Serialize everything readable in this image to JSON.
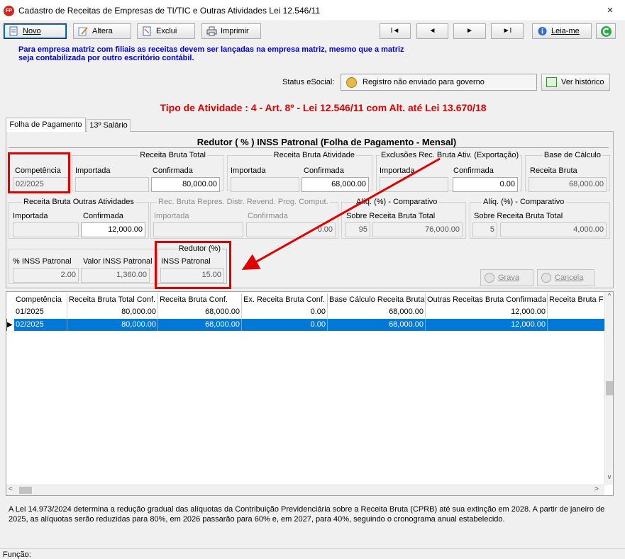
{
  "window": {
    "title": "Cadastro de Receitas de Empresas de TI/TIC e Outras Atividades Lei 12.546/11",
    "app_icon_text": "FP",
    "close": "×"
  },
  "toolbar": {
    "new": "Novo",
    "edit": "Altera",
    "delete": "Exclui",
    "print": "Imprimir",
    "first": "I◄",
    "prev": "◄",
    "next": "►",
    "last": "►I",
    "readme": "Leia-me"
  },
  "info": {
    "matrix_note_line1": "Para empresa matriz com filiais as receitas devem ser lançadas na empresa matriz, mesmo que a matriz",
    "matrix_note_line2": "seja contabilizada por outro escritório contábil.",
    "esocial_label": "Status eSocial:",
    "esocial_status": "Registro não enviado para governo",
    "history_button": "Ver histórico",
    "activity_type": "Tipo de Atividade : 4 - Art. 8º - Lei 12.546/11 com Alt. até Lei 13.670/18"
  },
  "tabs": {
    "payroll": "Folha de Pagamento",
    "thirteenth": "13º Salário"
  },
  "form": {
    "section_title": "Redutor ( % ) INSS Patronal (Folha de Pagamento - Mensal)",
    "competencia_label": "Competência",
    "competencia_value": "02/2025",
    "receita_bruta_total": {
      "title": "Receita Bruta Total",
      "importada": "Importada",
      "confirmada": "Confirmada",
      "importada_value": "",
      "confirmada_value": "80,000.00"
    },
    "receita_bruta_atividade": {
      "title": "Receita Bruta Atividade",
      "importada": "Importada",
      "confirmada": "Confirmada",
      "importada_value": "",
      "confirmada_value": "68,000.00"
    },
    "exclusoes": {
      "title": "Exclusões Rec. Bruta Ativ. (Exportação)",
      "importada": "Importada",
      "confirmada": "Confirmada",
      "importada_value": "",
      "confirmada_value": "0.00"
    },
    "base_calculo": {
      "title": "Base de Cálculo",
      "label": "Receita Bruta",
      "value": "68,000.00"
    },
    "outras_atividades": {
      "title": "Receita Bruta Outras Atividades",
      "importada": "Importada",
      "confirmada": "Confirmada",
      "importada_value": "",
      "confirmada_value": "12,000.00"
    },
    "repres_distr": {
      "title": "Rec. Bruta Repres. Distr. Revend. Prog. Comput.",
      "importada": "Importada",
      "confirmada": "Confirmada",
      "importada_value": "",
      "confirmada_value": "0.00"
    },
    "aliq_comparativo_1": {
      "title": "Alíq. (%) - Comparativo",
      "label": "Sobre Receita Bruta Total",
      "pct": "95",
      "value": "76,000.00"
    },
    "aliq_comparativo_2": {
      "title": "Alíq. (%) - Comparativo",
      "label": "Sobre Receita Bruta Total",
      "pct": "5",
      "value": "4,000.00"
    },
    "inss_patronal_pct_label": "% INSS Patronal",
    "inss_patronal_pct_value": "2.00",
    "valor_inss_label": "Valor INSS Patronal",
    "valor_inss_value": "1,360.00",
    "redutor": {
      "title": "Redutor (%)",
      "label": "INSS Patronal",
      "value": "15.00"
    },
    "save_button": "Grava",
    "cancel_button": "Cancela"
  },
  "grid": {
    "headers": [
      "Competência",
      "Receita Bruta Total Conf.",
      "Receita Bruta Conf.",
      "Ex. Receita Bruta Conf.",
      "Base Cálculo Receita Bruta",
      "Outras Receitas Bruta Confirmada",
      "Receita Bruta F"
    ],
    "rows": [
      [
        "01/2025",
        "80,000.00",
        "68,000.00",
        "0.00",
        "68,000.00",
        "12,000.00",
        ""
      ],
      [
        "02/2025",
        "80,000.00",
        "68,000.00",
        "0.00",
        "68,000.00",
        "12,000.00",
        ""
      ]
    ],
    "selected_marker": "▶",
    "scroll_left": "<",
    "scroll_right": ">",
    "scroll_up": "^",
    "scroll_down": "v"
  },
  "footer": {
    "note": "A Lei 14.973/2024 determina a redução gradual das alíquotas da Contribuição Previdenciária sobre a Receita Bruta (CPRB) até sua extinção em 2028. A partir de janeiro de 2025, as alíquotas serão reduzidas para 80%, em 2026 passarão para 60% e, em 2027, para 40%, seguindo o cronograma anual estabelecido.",
    "function_label": "Função:"
  },
  "colors": {
    "accent_blue": "#0078d7",
    "info_blue": "#0000dd",
    "alert_red": "#e00000"
  }
}
